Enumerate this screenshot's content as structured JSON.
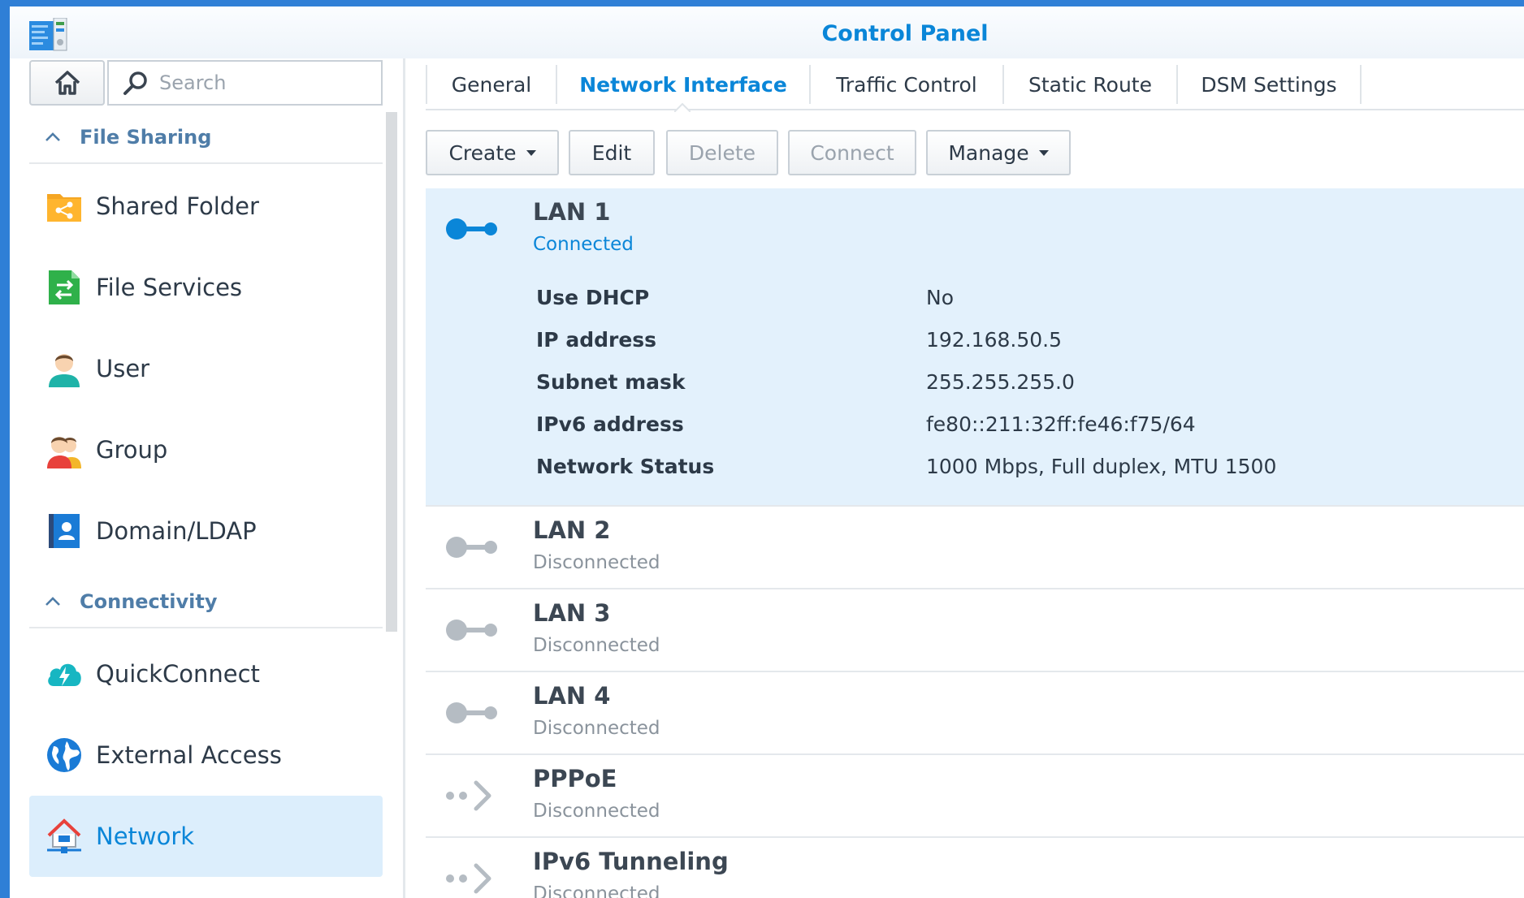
{
  "window": {
    "title": "Control Panel"
  },
  "search": {
    "placeholder": "Search"
  },
  "sidebar": {
    "sections": [
      {
        "label": "File Sharing"
      },
      {
        "label": "Connectivity"
      }
    ],
    "items": [
      {
        "label": "Shared Folder",
        "icon": "shared-folder-icon"
      },
      {
        "label": "File Services",
        "icon": "file-services-icon"
      },
      {
        "label": "User",
        "icon": "user-icon"
      },
      {
        "label": "Group",
        "icon": "group-icon"
      },
      {
        "label": "Domain/LDAP",
        "icon": "domain-ldap-icon"
      },
      {
        "label": "QuickConnect",
        "icon": "quickconnect-icon"
      },
      {
        "label": "External Access",
        "icon": "external-access-icon"
      },
      {
        "label": "Network",
        "icon": "network-icon",
        "active": true
      }
    ]
  },
  "tabs": [
    {
      "label": "General"
    },
    {
      "label": "Network Interface",
      "active": true
    },
    {
      "label": "Traffic Control"
    },
    {
      "label": "Static Route"
    },
    {
      "label": "DSM Settings"
    }
  ],
  "toolbar": {
    "create": "Create",
    "edit": "Edit",
    "delete": "Delete",
    "connect": "Connect",
    "manage": "Manage"
  },
  "interfaces": [
    {
      "name": "LAN 1",
      "status": "Connected",
      "details": [
        {
          "key": "Use DHCP",
          "value": "No"
        },
        {
          "key": "IP address",
          "value": "192.168.50.5"
        },
        {
          "key": "Subnet mask",
          "value": "255.255.255.0"
        },
        {
          "key": "IPv6 address",
          "value": "fe80::211:32ff:fe46:f75/64"
        },
        {
          "key": "Network Status",
          "value": "1000 Mbps, Full duplex, MTU 1500"
        }
      ]
    },
    {
      "name": "LAN 2",
      "status": "Disconnected"
    },
    {
      "name": "LAN 3",
      "status": "Disconnected"
    },
    {
      "name": "LAN 4",
      "status": "Disconnected"
    },
    {
      "name": "PPPoE",
      "status": "Disconnected"
    },
    {
      "name": "IPv6 Tunneling",
      "status": "Disconnected"
    }
  ],
  "colors": {
    "accent": "#0a86d8",
    "selected_bg": "#e3f1fc",
    "desktop": "#2f7fd6"
  }
}
